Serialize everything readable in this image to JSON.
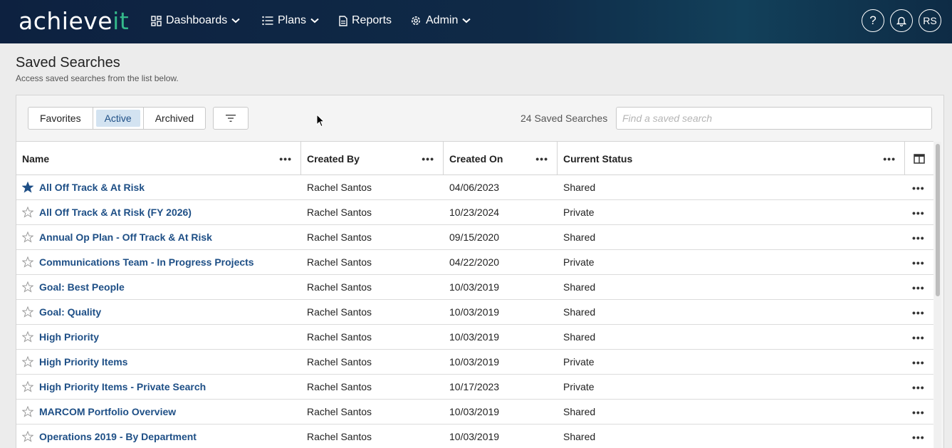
{
  "app": {
    "logo_main": "achieve",
    "logo_accent": "it",
    "nav": [
      {
        "label": "Dashboards"
      },
      {
        "label": "Plans"
      },
      {
        "label": "Reports"
      },
      {
        "label": "Admin"
      }
    ],
    "help_label": "?",
    "avatar_initials": "RS"
  },
  "page": {
    "title": "Saved Searches",
    "subtitle": "Access saved searches from the list below."
  },
  "toolbar": {
    "tabs": [
      "Favorites",
      "Active",
      "Archived"
    ],
    "active_tab": "Active",
    "count_text": "24 Saved Searches",
    "search_placeholder": "Find a saved search"
  },
  "table": {
    "columns": [
      "Name",
      "Created By",
      "Created On",
      "Current Status"
    ],
    "rows": [
      {
        "name": "All Off Track & At Risk",
        "created_by": "Rachel Santos",
        "created_on": "04/06/2023",
        "status": "Shared",
        "favorite": true
      },
      {
        "name": "All Off Track & At Risk (FY 2026)",
        "created_by": "Rachel Santos",
        "created_on": "10/23/2024",
        "status": "Private",
        "favorite": false
      },
      {
        "name": "Annual Op Plan - Off Track & At Risk",
        "created_by": "Rachel Santos",
        "created_on": "09/15/2020",
        "status": "Shared",
        "favorite": false
      },
      {
        "name": "Communications Team - In Progress Projects",
        "created_by": "Rachel Santos",
        "created_on": "04/22/2020",
        "status": "Private",
        "favorite": false
      },
      {
        "name": "Goal: Best People",
        "created_by": "Rachel Santos",
        "created_on": "10/03/2019",
        "status": "Shared",
        "favorite": false
      },
      {
        "name": "Goal: Quality",
        "created_by": "Rachel Santos",
        "created_on": "10/03/2019",
        "status": "Shared",
        "favorite": false
      },
      {
        "name": "High Priority",
        "created_by": "Rachel Santos",
        "created_on": "10/03/2019",
        "status": "Shared",
        "favorite": false
      },
      {
        "name": "High Priority Items",
        "created_by": "Rachel Santos",
        "created_on": "10/03/2019",
        "status": "Private",
        "favorite": false
      },
      {
        "name": "High Priority Items - Private Search",
        "created_by": "Rachel Santos",
        "created_on": "10/17/2023",
        "status": "Private",
        "favorite": false
      },
      {
        "name": "MARCOM Portfolio Overview",
        "created_by": "Rachel Santos",
        "created_on": "10/03/2019",
        "status": "Shared",
        "favorite": false
      },
      {
        "name": "Operations 2019 - By Department",
        "created_by": "Rachel Santos",
        "created_on": "10/03/2019",
        "status": "Shared",
        "favorite": false
      }
    ]
  },
  "colors": {
    "link": "#1e4f86",
    "logo_accent": "#34b88a",
    "active_tab_bg": "#d3e3f1"
  }
}
